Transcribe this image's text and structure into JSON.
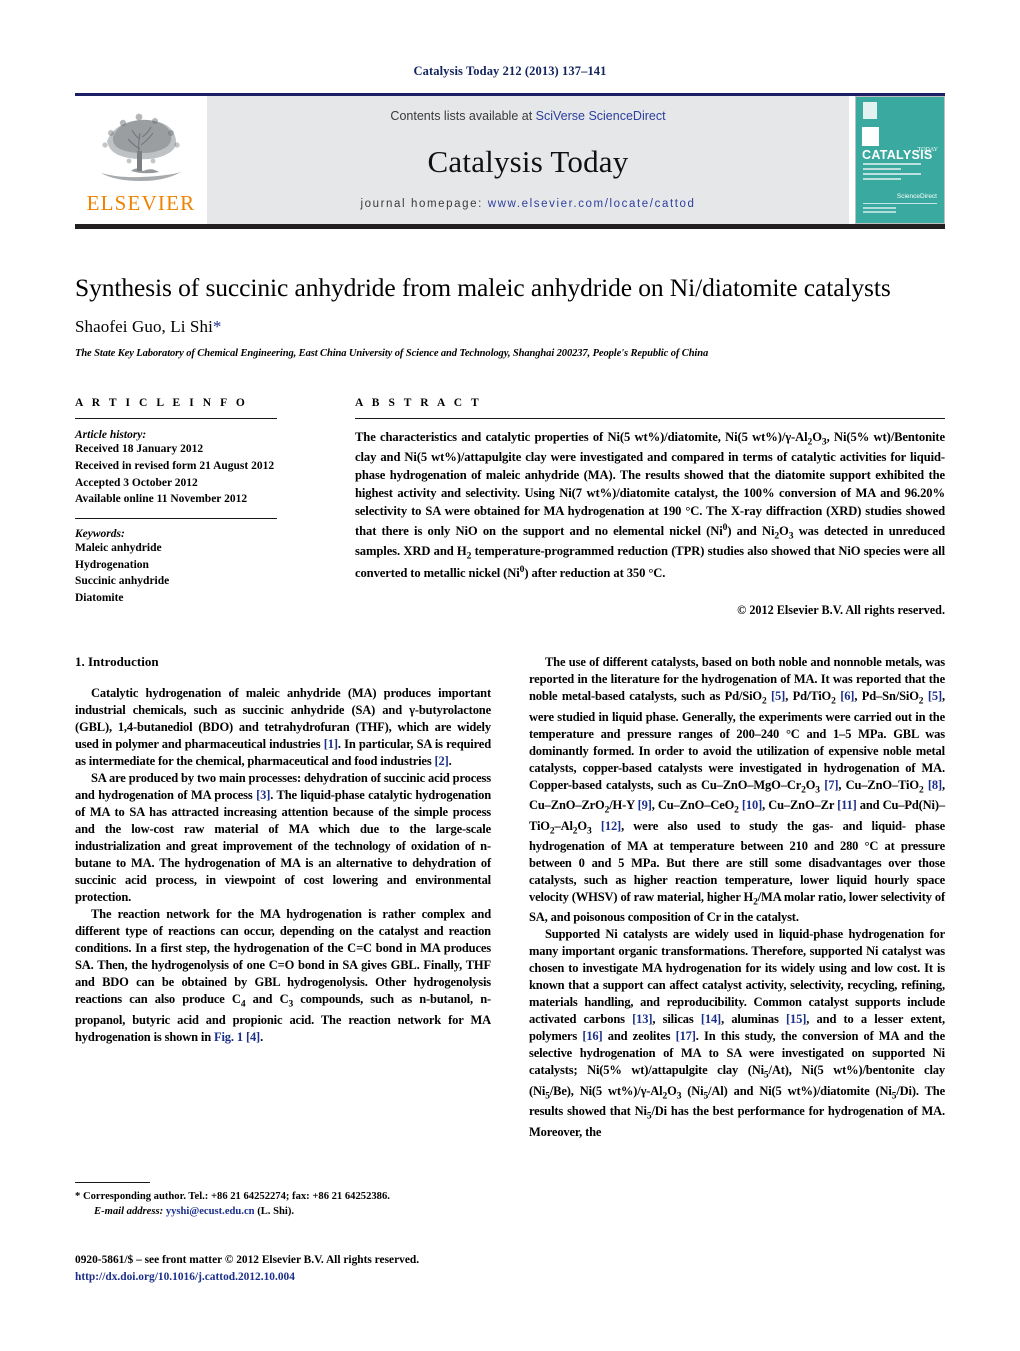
{
  "running_head": "Catalysis Today 212 (2013) 137–141",
  "masthead": {
    "publisher_name": "ELSEVIER",
    "contents_prefix": "Contents lists available at ",
    "contents_link": "SciVerse ScienceDirect",
    "journal_title": "Catalysis Today",
    "homepage_prefix": "journal homepage: ",
    "homepage_url": "www.elsevier.com/locate/cattod",
    "cover_title": "CATALYSIS",
    "cover_subtitle": "TODAY",
    "cover_footer": "ScienceDirect",
    "accent_orange": "#ef8200",
    "link_blue": "#2b3f9e",
    "band_gray": "#e6e7e9",
    "cover_teal": "#3aa9a0",
    "rule_navy": "#1b1f66"
  },
  "article": {
    "title": "Synthesis of succinic anhydride from maleic anhydride on Ni/diatomite catalysts",
    "authors": "Shaofei Guo, Li Shi",
    "corresponding_marker": "*",
    "affiliation": "The State Key Laboratory of Chemical Engineering, East China University of Science and Technology, Shanghai 200237, People's Republic of China"
  },
  "article_info": {
    "heading": "A R T I C L E    I N F O",
    "history_label": "Article history:",
    "history": [
      "Received 18 January 2012",
      "Received in revised form 21 August 2012",
      "Accepted 3 October 2012",
      "Available online 11 November 2012"
    ],
    "keywords_label": "Keywords:",
    "keywords": [
      "Maleic anhydride",
      "Hydrogenation",
      "Succinic anhydride",
      "Diatomite"
    ]
  },
  "abstract": {
    "heading": "A B S T R A C T",
    "copyright": "© 2012 Elsevier B.V. All rights reserved."
  },
  "introduction": {
    "heading": "1.  Introduction"
  },
  "footnote": {
    "corresponding": "* Corresponding author. Tel.: +86 21 64252274; fax: +86 21 64252386.",
    "email_label": "E-mail address:",
    "email": "yyshi@ecust.edu.cn",
    "email_suffix": "(L. Shi)."
  },
  "footer": {
    "issn_line": "0920-5861/$ – see front matter © 2012 Elsevier B.V. All rights reserved.",
    "doi": "http://dx.doi.org/10.1016/j.cattod.2012.10.004"
  }
}
